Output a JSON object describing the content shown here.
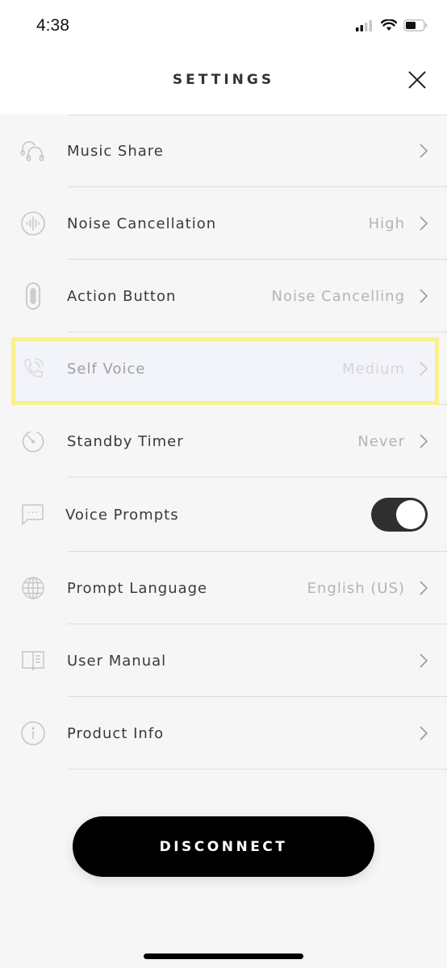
{
  "status_bar": {
    "time": "4:38",
    "icons": [
      "cellular-signal-icon",
      "wifi-icon",
      "battery-icon"
    ]
  },
  "header": {
    "title": "SETTINGS",
    "close_icon": "close-icon"
  },
  "settings": [
    {
      "label": "Music Share",
      "value": "",
      "icon": "headphones-share-icon",
      "control": "chevron"
    },
    {
      "label": "Noise Cancellation",
      "value": "High",
      "icon": "sound-wave-icon",
      "control": "chevron"
    },
    {
      "label": "Action Button",
      "value": "Noise Cancelling",
      "icon": "earbud-button-icon",
      "control": "chevron"
    },
    {
      "label": "Self Voice",
      "value": "Medium",
      "icon": "phone-call-icon",
      "control": "chevron",
      "highlighted": true
    },
    {
      "label": "Standby Timer",
      "value": "Never",
      "icon": "timer-icon",
      "control": "chevron"
    },
    {
      "label": "Voice Prompts",
      "value": "",
      "icon": "chat-bubble-icon",
      "control": "toggle",
      "toggle_on": true
    },
    {
      "label": "Prompt Language",
      "value": "English (US)",
      "icon": "globe-icon",
      "control": "chevron"
    },
    {
      "label": "User Manual",
      "value": "",
      "icon": "book-icon",
      "control": "chevron"
    },
    {
      "label": "Product Info",
      "value": "",
      "icon": "info-icon",
      "control": "chevron"
    }
  ],
  "disconnect_label": "DISCONNECT",
  "colors": {
    "highlight_border": "#f8f28c",
    "toggle_on": "#2f2f2f",
    "button_bg": "#000000",
    "value_text": "#b4b4b4",
    "background": "#f6f6f6"
  }
}
